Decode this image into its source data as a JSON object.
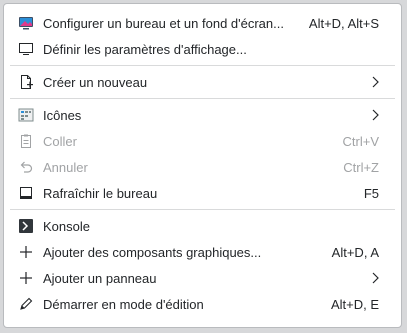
{
  "menu": {
    "items": [
      {
        "label": "Configurer un bureau et un fond d'écran...",
        "shortcut": "Alt+D, Alt+S",
        "icon": "desktop-wallpaper-icon",
        "disabled": false
      },
      {
        "label": "Définir les paramètres d'affichage...",
        "shortcut": "",
        "icon": "monitor-icon",
        "disabled": false
      },
      {
        "label": "Créer un nouveau",
        "shortcut": "",
        "icon": "new-document-icon",
        "disabled": false,
        "submenu": true
      },
      {
        "label": "Icônes",
        "shortcut": "",
        "icon": "icons-grid-icon",
        "disabled": false,
        "submenu": true
      },
      {
        "label": "Coller",
        "shortcut": "Ctrl+V",
        "icon": "paste-icon",
        "disabled": true
      },
      {
        "label": "Annuler",
        "shortcut": "Ctrl+Z",
        "icon": "undo-icon",
        "disabled": true
      },
      {
        "label": "Rafraîchir le bureau",
        "shortcut": "F5",
        "icon": "refresh-desktop-icon",
        "disabled": false
      },
      {
        "label": "Konsole",
        "shortcut": "",
        "icon": "terminal-icon",
        "disabled": false
      },
      {
        "label": "Ajouter des composants graphiques...",
        "shortcut": "Alt+D, A",
        "icon": "plus-icon",
        "disabled": false
      },
      {
        "label": "Ajouter un panneau",
        "shortcut": "",
        "icon": "plus-icon",
        "disabled": false,
        "submenu": true
      },
      {
        "label": "Démarrer en mode d'édition",
        "shortcut": "Alt+D, E",
        "icon": "pencil-icon",
        "disabled": false
      }
    ]
  },
  "colors": {
    "text": "#232629",
    "disabled_text": "#a1a3a5",
    "separator": "#d9dadb",
    "background": "#ffffff"
  }
}
